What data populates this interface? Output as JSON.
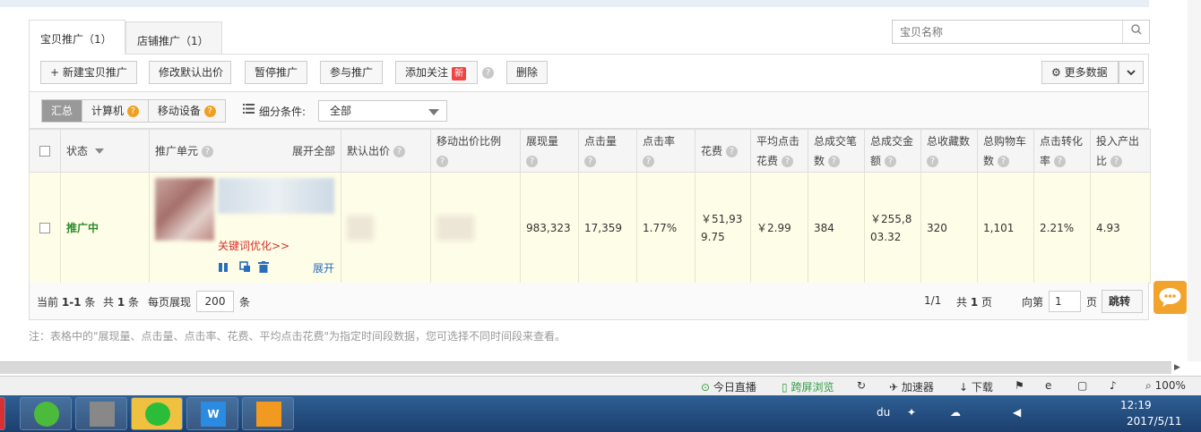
{
  "tabs": [
    {
      "label": "宝贝推广（1）",
      "active": true
    },
    {
      "label": "店铺推广（1）",
      "active": false
    }
  ],
  "search": {
    "placeholder": "宝贝名称"
  },
  "toolbar": {
    "new_label": "+ 新建宝贝推广",
    "edit_bid_label": "修改默认出价",
    "pause_label": "暂停推广",
    "join_label": "参与推广",
    "follow_label": "添加关注",
    "new_badge": "新",
    "delete_label": "删除",
    "more_label": "更多数据"
  },
  "filter": {
    "seg": [
      "汇总",
      "计算机",
      "移动设备"
    ],
    "cond_label": "细分条件:",
    "cond_value": "全部"
  },
  "table": {
    "headers": {
      "status": "状态",
      "unit": "推广单元",
      "expand_all": "展开全部",
      "bid": "默认出价",
      "mobile_ratio": "移动出价比例",
      "impressions": "展现量",
      "clicks": "点击量",
      "ctr": "点击率",
      "cost": "花费",
      "avg_cpc_1": "平均点击",
      "avg_cpc_2": "花费",
      "orders_1": "总成交笔",
      "orders_2": "数",
      "gmv_1": "总成交金",
      "gmv_2": "额",
      "favs": "总收藏数",
      "cart_1": "总购物车",
      "cart_2": "数",
      "cvr_1": "点击转化",
      "cvr_2": "率",
      "roi_1": "投入产出",
      "roi_2": "比"
    },
    "row": {
      "status": "推广中",
      "keyword_link": "关键词优化>>",
      "expand": "展开",
      "impressions": "983,323",
      "clicks": "17,359",
      "ctr": "1.77%",
      "cost_1": "￥51,93",
      "cost_2": "9.75",
      "avg_cpc": "￥2.99",
      "orders": "384",
      "gmv_1": "￥255,8",
      "gmv_2": "03.32",
      "favs": "320",
      "cart": "1,101",
      "cvr": "2.21%",
      "roi": "4.93"
    }
  },
  "pager": {
    "current_prefix": "当前",
    "current_range": "1-1",
    "current_suffix": "条",
    "total_prefix": "共",
    "total_count": "1",
    "total_suffix": "条",
    "per_page_label": "每页展现",
    "per_page": "200",
    "per_page_unit": "条",
    "page_frac": "1/1",
    "pages_prefix": "共",
    "pages_count": "1",
    "pages_suffix": "页",
    "goto_prefix": "向第",
    "goto_value": "1",
    "goto_suffix": "页",
    "goto_button": "跳转"
  },
  "note": "注：表格中的\"展现量、点击量、点击率、花费、平均点击花费\"为指定时间段数据，您可选择不同时间段来查看。",
  "statusbar": {
    "live": "今日直播",
    "cross_screen": "跨屏浏览",
    "accelerator": "加速器",
    "download": "下载",
    "zoom": "100%"
  },
  "taskbar": {
    "time": "12:19",
    "date": "2017/5/11"
  },
  "colors": {
    "row_bg": "#fefde7",
    "status_green": "#2e8b2e",
    "link_red": "#d9302c",
    "badge_red": "#e44444",
    "orange": "#f0a020"
  }
}
